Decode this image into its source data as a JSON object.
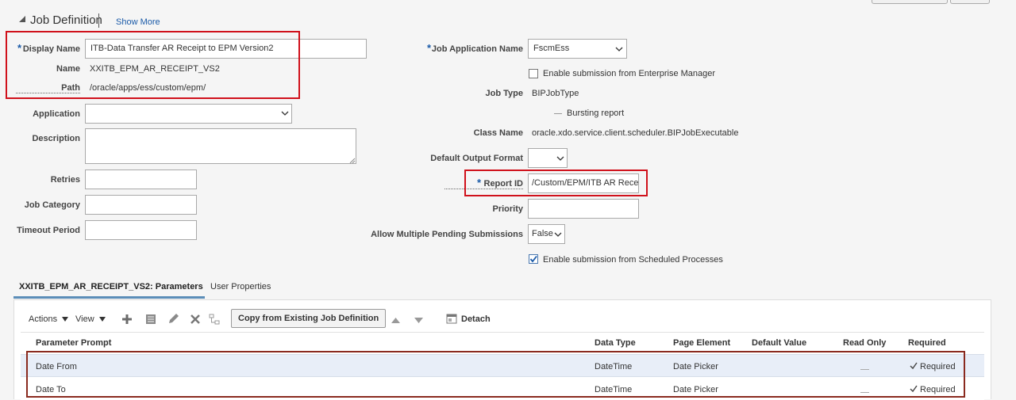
{
  "section": {
    "title": "Job Definition",
    "show_more": "Show More"
  },
  "left_fields": {
    "display_name_label": "Display Name",
    "display_name_value": "ITB-Data Transfer AR Receipt to EPM Version2",
    "name_label": "Name",
    "name_value": "XXITB_EPM_AR_RECEIPT_VS2",
    "path_label": "Path",
    "path_value": "/oracle/apps/ess/custom/epm/",
    "application_label": "Application",
    "application_value": "",
    "description_label": "Description",
    "description_value": "",
    "retries_label": "Retries",
    "retries_value": "",
    "job_category_label": "Job Category",
    "job_category_value": "",
    "timeout_label": "Timeout Period",
    "timeout_value": ""
  },
  "right_fields": {
    "job_app_label": "Job Application Name",
    "job_app_value": "FscmEss",
    "enable_em_label": "Enable submission from Enterprise Manager",
    "job_type_label": "Job Type",
    "job_type_value": "BIPJobType",
    "bursting_label": "Bursting report",
    "class_name_label": "Class Name",
    "class_name_value": "oracle.xdo.service.client.scheduler.BIPJobExecutable",
    "default_output_label": "Default Output Format",
    "default_output_value": "",
    "report_id_label": "Report ID",
    "report_id_value": "/Custom/EPM/ITB AR Rece",
    "priority_label": "Priority",
    "priority_value": "",
    "allow_multiple_label": "Allow Multiple Pending Submissions",
    "allow_multiple_value": "False",
    "enable_scheduled_label": "Enable submission from Scheduled Processes"
  },
  "tabs": [
    {
      "label": "XXITB_EPM_AR_RECEIPT_VS2: Parameters"
    },
    {
      "label": "User Properties"
    }
  ],
  "toolbar": {
    "actions": "Actions",
    "view": "View",
    "copy_button": "Copy from Existing Job Definition",
    "detach": "Detach"
  },
  "table": {
    "columns": [
      "Parameter Prompt",
      "Data Type",
      "Page Element",
      "Default Value",
      "Read Only",
      "Required"
    ],
    "rows": [
      {
        "prompt": "Date From",
        "data_type": "DateTime",
        "page_element": "Date Picker",
        "default_value": "",
        "read_only": "",
        "required": "Required"
      },
      {
        "prompt": "Date To",
        "data_type": "DateTime",
        "page_element": "Date Picker",
        "default_value": "",
        "read_only": "",
        "required": "Required"
      }
    ]
  },
  "colors": {
    "highlight_box": "#d0111b",
    "row_highlight_box": "#8a2a1f",
    "link": "#1a5aa8",
    "selected_row": "#e8eef8"
  }
}
